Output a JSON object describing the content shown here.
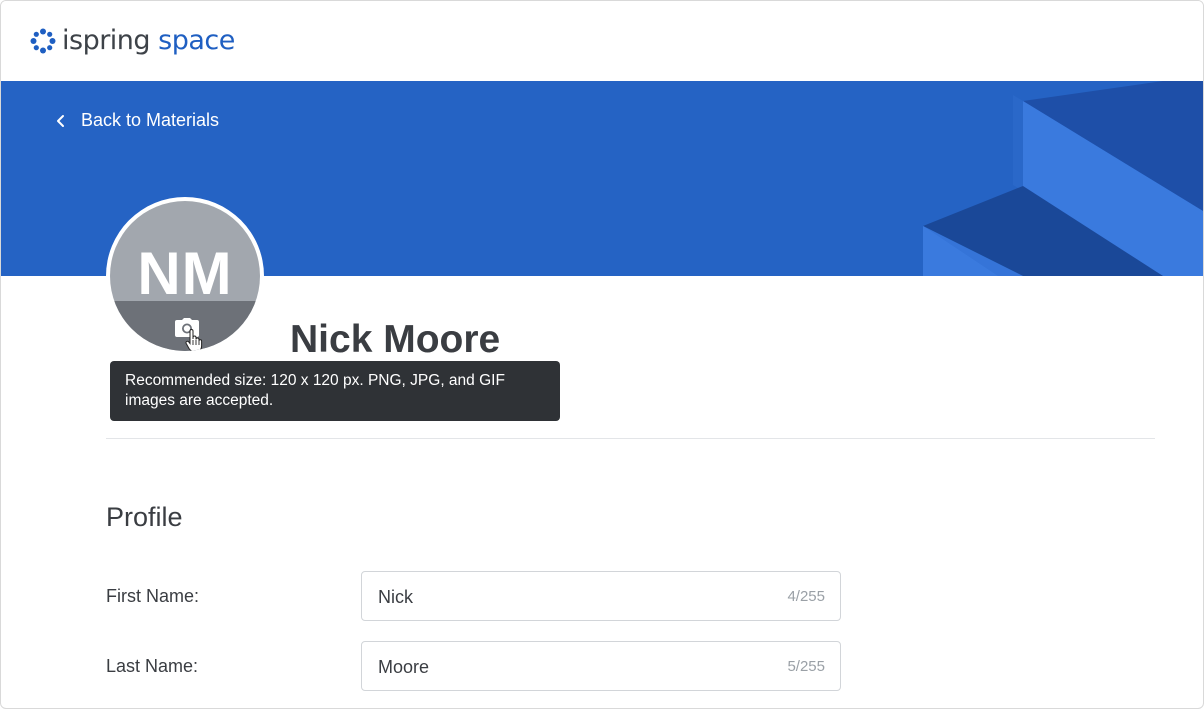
{
  "app": {
    "logo_word1": "ispring",
    "logo_word2": "space",
    "brand_color": "#1f5fc2",
    "banner_color": "#2563c4"
  },
  "nav": {
    "back_label": "Back to Materials",
    "back_icon": "chevron-left-icon"
  },
  "user": {
    "initials": "NM",
    "full_name": "Nick Moore",
    "avatar_icon": "camera-icon"
  },
  "tooltip": {
    "text": "Recommended size: 120 x 120 px. PNG, JPG, and GIF images are accepted."
  },
  "profile": {
    "section_title": "Profile",
    "fields": [
      {
        "label": "First Name:",
        "value": "Nick",
        "count": "4/255"
      },
      {
        "label": "Last Name:",
        "value": "Moore",
        "count": "5/255"
      }
    ]
  }
}
